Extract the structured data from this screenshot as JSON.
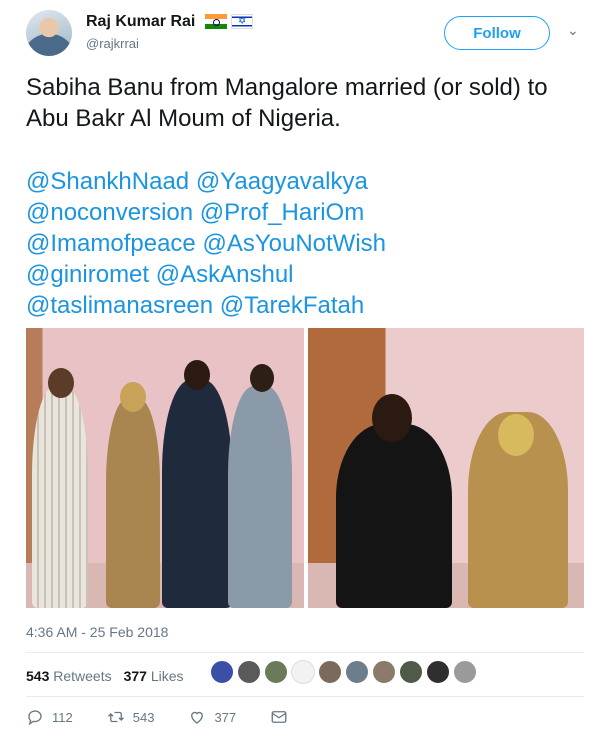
{
  "user": {
    "name": "Raj Kumar Rai",
    "handle": "@rajkrrai",
    "flags": [
      "india-flag-icon",
      "israel-flag-icon"
    ]
  },
  "follow_label": "Follow",
  "tweet": {
    "text": "Sabiha Banu from Mangalore married (or sold) to Abu Bakr Al Moum of Nigeria.",
    "mentions": [
      "@ShankhNaad",
      "@Yaagyavalkya",
      "@noconversion",
      "@Prof_HariOm",
      "@Imamofpeace",
      "@AsYouNotWish",
      "@giniromet",
      "@AskAnshul",
      "@taslimanasreen",
      "@TarekFatah"
    ]
  },
  "timestamp": "4:36 AM - 25 Feb 2018",
  "stats": {
    "retweets_count": "543",
    "retweets_label": "Retweets",
    "likes_count": "377",
    "likes_label": "Likes"
  },
  "actions": {
    "replies": "112",
    "retweets": "543",
    "likes": "377"
  },
  "colors": {
    "accent": "#1da1f2",
    "link": "#1b95e0",
    "muted": "#657786",
    "text": "#14171a"
  }
}
